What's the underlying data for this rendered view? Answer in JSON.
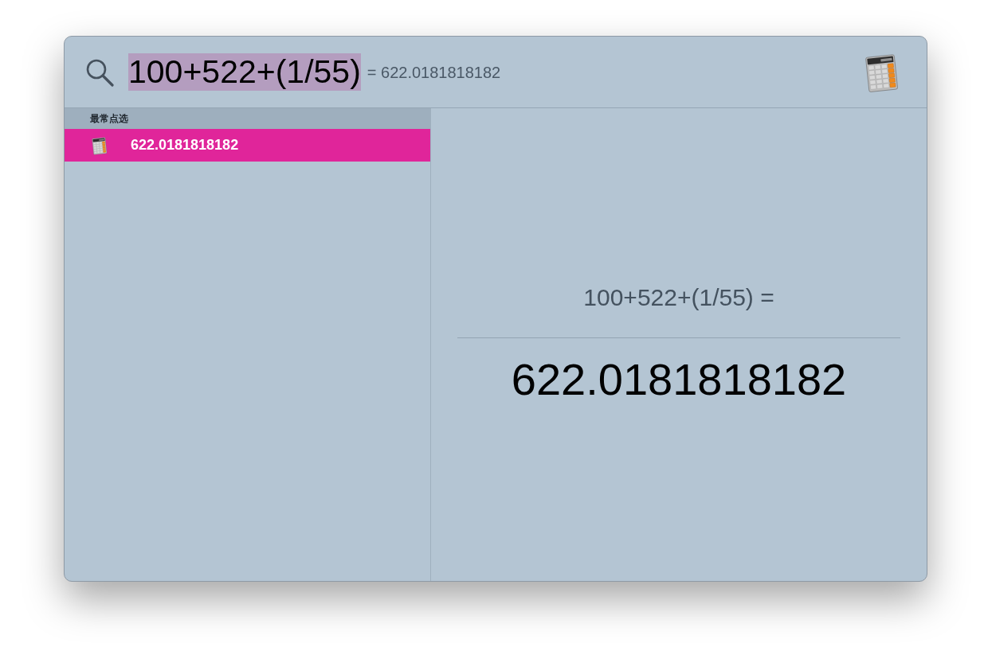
{
  "search": {
    "query": "100+522+(1/55)",
    "selected": true,
    "inline_result": "= 622.0181818182"
  },
  "results": {
    "sections": [
      {
        "title": "最常点选",
        "items": [
          {
            "label": "622.0181818182",
            "selected": true
          }
        ]
      }
    ]
  },
  "preview": {
    "expression": "100+522+(1/55) =",
    "result": "622.0181818182"
  }
}
